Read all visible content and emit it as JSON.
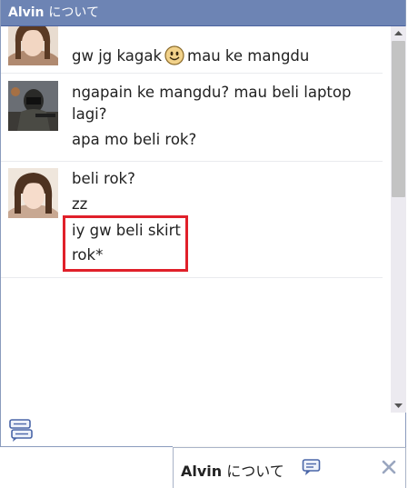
{
  "window": {
    "title_name": "Alvin",
    "title_suffix": "について"
  },
  "messages": [
    {
      "avatar": "girl-avatar",
      "lines": [
        "gw jg kagak",
        "mau ke mangdu"
      ],
      "emoticon": "smiley-icon"
    },
    {
      "avatar": "soldier-avatar",
      "lines": [
        "ngapain ke mangdu? mau beli laptop",
        "lagi?",
        "apa mo beli rok?"
      ]
    },
    {
      "avatar": "girl-avatar",
      "lines": [
        "beli rok?",
        "zz",
        "iy gw beli skirt",
        "rok*"
      ]
    }
  ],
  "tab": {
    "name": "Alvin",
    "suffix": "について",
    "close_icon": "close-icon",
    "chat_icon": "chat-bubble-icon"
  },
  "colors": {
    "titlebar": "#6d84b4",
    "highlight": "#e0202a"
  }
}
